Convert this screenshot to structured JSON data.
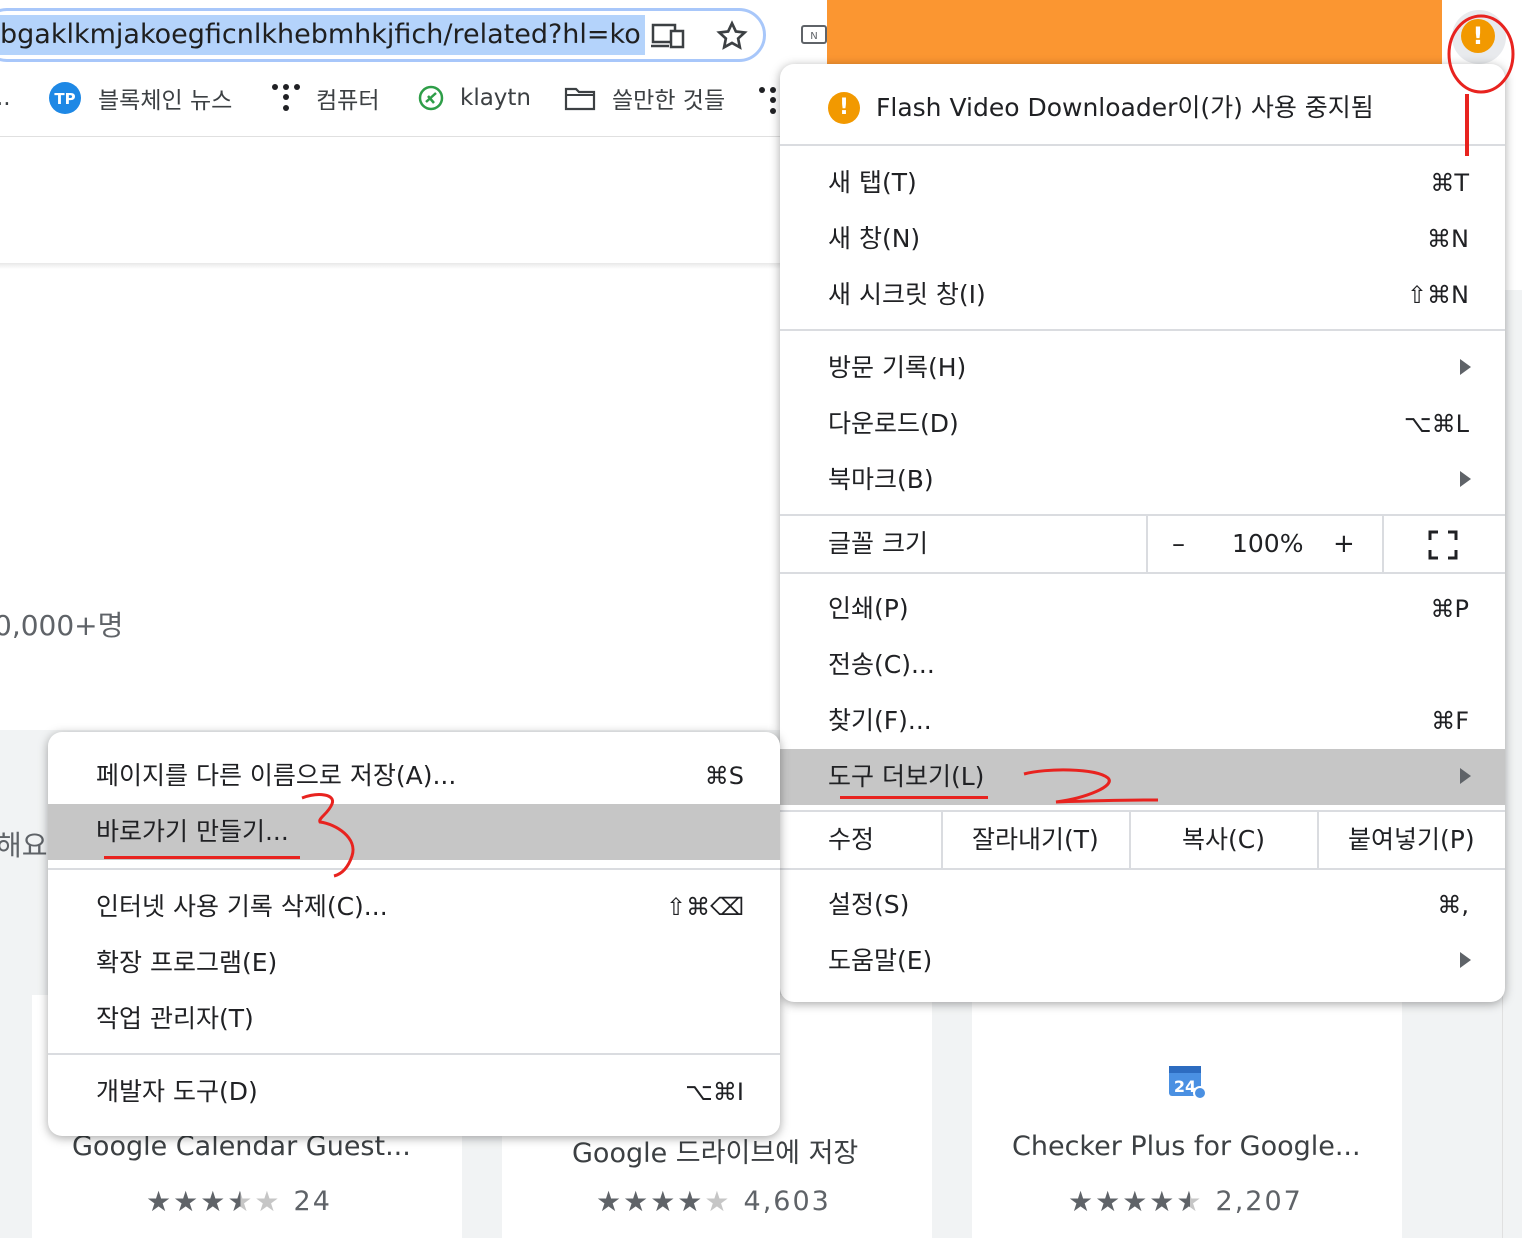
{
  "address_bar": {
    "url": "bgaklkmjakoegficnlkhebmhkjfich/related?hl=ko"
  },
  "bookmarks": [
    {
      "label": "..",
      "icon": "overflow-dots-icon"
    },
    {
      "label": "블록체인 뉴스",
      "icon": "tokenpost-logo-icon"
    },
    {
      "label": "컴퓨터",
      "icon": "dots-grid-icon"
    },
    {
      "label": "klaytn",
      "icon": "klaytn-logo-icon"
    },
    {
      "label": "쓸만한 것들",
      "icon": "folder-icon"
    }
  ],
  "page": {
    "users_count": "0,000+명",
    "cut_text": "해요",
    "cards": [
      {
        "title": "Google Calendar Guest...",
        "rating": 3.5,
        "reviews": "24"
      },
      {
        "title": "Google 드라이브에 저장",
        "rating": 4,
        "reviews": "4,603"
      },
      {
        "title": "Checker Plus for Google...",
        "rating": 4.5,
        "reviews": "2,207",
        "icon_text": "24"
      }
    ]
  },
  "main_menu": {
    "warning": "Flash Video Downloader이(가) 사용 중지됨",
    "items": [
      {
        "label": "새 탭(T)",
        "shortcut": "⌘T"
      },
      {
        "label": "새 창(N)",
        "shortcut": "⌘N"
      },
      {
        "label": "새 시크릿 창(I)",
        "shortcut": "⇧⌘N"
      },
      {
        "label": "방문 기록(H)",
        "shortcut": ""
      },
      {
        "label": "다운로드(D)",
        "shortcut": "⌥⌘L"
      },
      {
        "label": "북마크(B)",
        "shortcut": ""
      },
      {
        "label": "인쇄(P)",
        "shortcut": "⌘P"
      },
      {
        "label": "전송(C)...",
        "shortcut": ""
      },
      {
        "label": "찾기(F)...",
        "shortcut": "⌘F"
      },
      {
        "label": "도구 더보기(L)",
        "shortcut": ""
      },
      {
        "label": "설정(S)",
        "shortcut": "⌘,"
      },
      {
        "label": "도움말(E)",
        "shortcut": ""
      }
    ],
    "zoom": {
      "label": "글꼴 크기",
      "minus": "–",
      "value": "100%",
      "plus": "+"
    },
    "edit": {
      "label": "수정",
      "cut": "잘라내기(T)",
      "copy": "복사(C)",
      "paste": "붙여넣기(P)"
    }
  },
  "sub_menu": {
    "items": [
      {
        "label": "페이지를 다른 이름으로 저장(A)...",
        "shortcut": "⌘S"
      },
      {
        "label": "바로가기 만들기...",
        "shortcut": ""
      },
      {
        "label": "인터넷 사용 기록 삭제(C)...",
        "shortcut": "⇧⌘⌫"
      },
      {
        "label": "확장 프로그램(E)",
        "shortcut": ""
      },
      {
        "label": "작업 관리자(T)",
        "shortcut": ""
      },
      {
        "label": "개발자 도구(D)",
        "shortcut": "⌥⌘I"
      }
    ]
  },
  "colors": {
    "highlight": "#c6c6c6",
    "annotation": "#e8231f",
    "warning": "#f29900",
    "orange_block": "#fb9631"
  }
}
